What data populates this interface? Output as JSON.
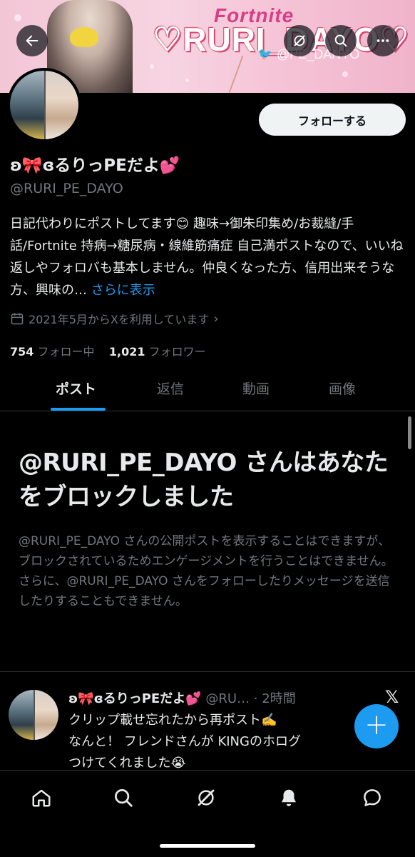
{
  "banner": {
    "overlay_small": "Fortnite",
    "overlay_name": "♡RURI_DAYO♡",
    "overlay_handle": "@PE_DANYO"
  },
  "header_buttons": {
    "back": "back-arrow-icon",
    "grok": "grok-icon",
    "search": "search-icon",
    "more": "more-icon"
  },
  "profile": {
    "follow_label": "フォローする",
    "display_name": "ʚ🎀ɞるりっPEだよ💕",
    "username": "@RURI_PE_DAYO",
    "bio": "日記代わりにポストしてます😊 趣味→御朱印集め/お裁縫/手話/Fortnite 持病→糖尿病・線維筋痛症 自己満ポストなので、いいね返しやフォロバも基本しません。仲良くなった方、信用出来そうな方、興味の…",
    "bio_more": "さらに表示",
    "joined": "2021年5月からXを利用しています",
    "following_count": "754",
    "following_label": "フォロー中",
    "followers_count": "1,021",
    "followers_label": "フォロワー"
  },
  "tabs": [
    {
      "label": "ポスト",
      "active": true
    },
    {
      "label": "返信",
      "active": false
    },
    {
      "label": "動画",
      "active": false
    },
    {
      "label": "画像",
      "active": false
    }
  ],
  "blocked": {
    "title": "@RURI_PE_DAYO さんはあなたをブロックしました",
    "text": "@RURI_PE_DAYO さんの公開ポストを表示することはできますが、ブロックされているためエンゲージメントを行うことはできません。さらに、@RURI_PE_DAYO さんをフォローしたりメッセージを送信したりすることもできません。"
  },
  "post": {
    "name": "ʚ🎀ɞるりっPEだよ💕",
    "handle_time": "@RU… · 2時間",
    "line1": "クリップ載せ忘れたから再ポスト✍️",
    "line2": "なんと！ フレンドさんが KINGのホログ",
    "line3": "つけてくれました😭",
    "x_logo": "𝕏"
  },
  "fab": {
    "label": "+"
  },
  "bottom_nav": [
    "home-icon",
    "search-icon",
    "grok-icon",
    "notifications-icon",
    "messages-icon"
  ],
  "colors": {
    "accent": "#1d9bf0",
    "background": "#000000",
    "muted": "#71767b"
  }
}
